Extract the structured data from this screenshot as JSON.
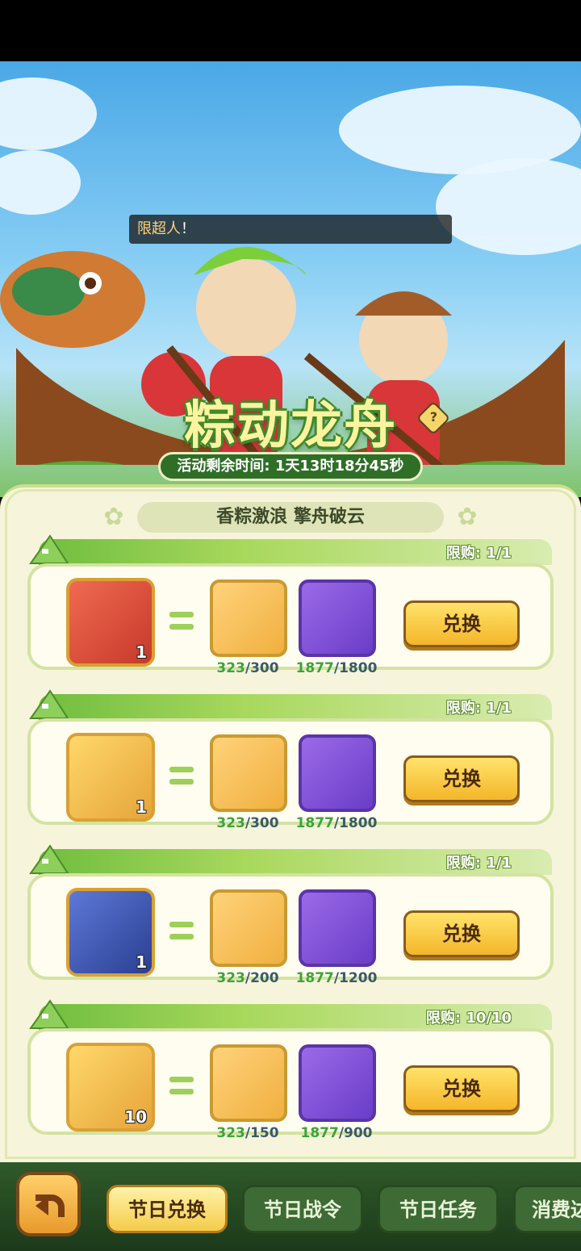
{
  "banner": {
    "speech_highlight": "限超人",
    "speech_rest": "！",
    "title": "粽动龙舟",
    "help_icon": "?",
    "timer": "活动剩余时间: 1天13时18分45秒"
  },
  "panel": {
    "subtitle": "香粽激浪 擎舟破云"
  },
  "exchanges": [
    {
      "limit": "限购: 1/1",
      "item_icon": "green-capsule",
      "item_qty": "1",
      "cost1": {
        "icon": "dragon-boat-head",
        "have": "323",
        "need": "/300"
      },
      "cost2": {
        "icon": "zongzi",
        "have": "1877",
        "need": "/1800"
      },
      "button": "兑换"
    },
    {
      "limit": "限购: 1/1",
      "item_icon": "mystery-chest",
      "item_qty": "1",
      "cost1": {
        "icon": "dragon-boat-head",
        "have": "323",
        "need": "/300"
      },
      "cost2": {
        "icon": "zongzi",
        "have": "1877",
        "need": "/1800"
      },
      "button": "兑换"
    },
    {
      "limit": "限购: 1/1",
      "item_icon": "blue-frame",
      "item_qty": "1",
      "cost1": {
        "icon": "dragon-boat-head",
        "have": "323",
        "need": "/200"
      },
      "cost2": {
        "icon": "zongzi",
        "have": "1877",
        "need": "/1200"
      },
      "button": "兑换"
    },
    {
      "limit": "限购: 10/10",
      "item_icon": "orange-potion",
      "item_qty": "10",
      "cost1": {
        "icon": "dragon-boat-head",
        "have": "323",
        "need": "/150"
      },
      "cost2": {
        "icon": "zongzi",
        "have": "1877",
        "need": "/900"
      },
      "button": "兑换"
    }
  ],
  "tabs": [
    {
      "label": "节日兑换",
      "active": true
    },
    {
      "label": "节日战令",
      "active": false
    },
    {
      "label": "节日任务",
      "active": false
    },
    {
      "label": "消费达",
      "active": false
    }
  ],
  "colors": {
    "accent_green": "#6fbd3f",
    "button_gold": "#f4b62a",
    "have_green": "#3fa23a"
  }
}
